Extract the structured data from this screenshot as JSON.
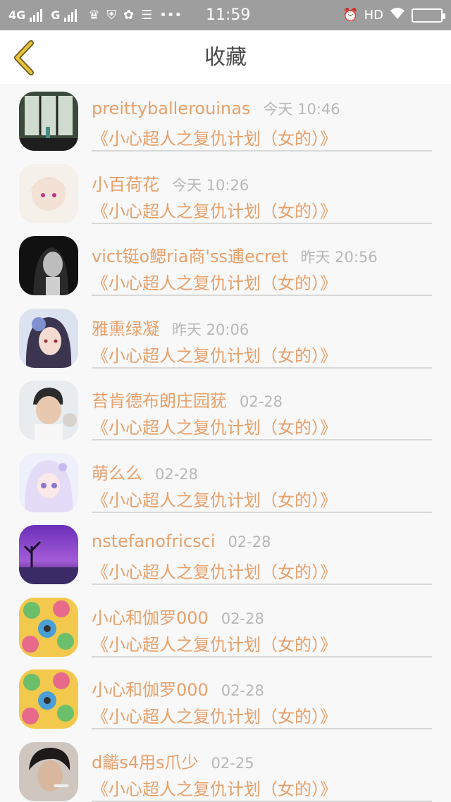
{
  "status_bar": {
    "net1": "4G",
    "net2": "G",
    "time": "11:59",
    "hd": "HD",
    "icons": [
      "signal-icon",
      "crown-icon",
      "shield-icon",
      "palette-icon",
      "app-icon",
      "more-icon",
      "alarm-icon",
      "wifi-icon",
      "battery-icon"
    ]
  },
  "nav": {
    "title": "收藏"
  },
  "colors": {
    "accent": "#e8a06a",
    "back_icon": "#e6c23a",
    "muted": "#b8b8b8"
  },
  "items": [
    {
      "name": "preittyballerouinas",
      "time": "今天 10:46",
      "book": "《小心超人之复仇计划（女的）》"
    },
    {
      "name": "小百荷花",
      "time": "今天 10:26",
      "book": "《小心超人之复仇计划（女的）》"
    },
    {
      "name": "vict铤o鳃ria商'ss逋ecret",
      "time": "昨天 20:56",
      "book": "《小心超人之复仇计划（女的）》"
    },
    {
      "name": "雅熏绿凝",
      "time": "昨天 20:06",
      "book": "《小心超人之复仇计划（女的）》"
    },
    {
      "name": "苔肯德布朗庄园莸",
      "time": "02-28",
      "book": "《小心超人之复仇计划（女的）》"
    },
    {
      "name": "萌么么",
      "time": "02-28",
      "book": "《小心超人之复仇计划（女的）》"
    },
    {
      "name": "nstefanofricsci",
      "time": "02-28",
      "book": "《小心超人之复仇计划（女的）》"
    },
    {
      "name": "小心和伽罗000",
      "time": "02-28",
      "book": "《小心超人之复仇计划（女的）》"
    },
    {
      "name": "小心和伽罗000",
      "time": "02-28",
      "book": "《小心超人之复仇计划（女的）》"
    },
    {
      "name": "d龤s4用s爪少",
      "time": "02-25",
      "book": "《小心超人之复仇计划（女的）》"
    }
  ]
}
